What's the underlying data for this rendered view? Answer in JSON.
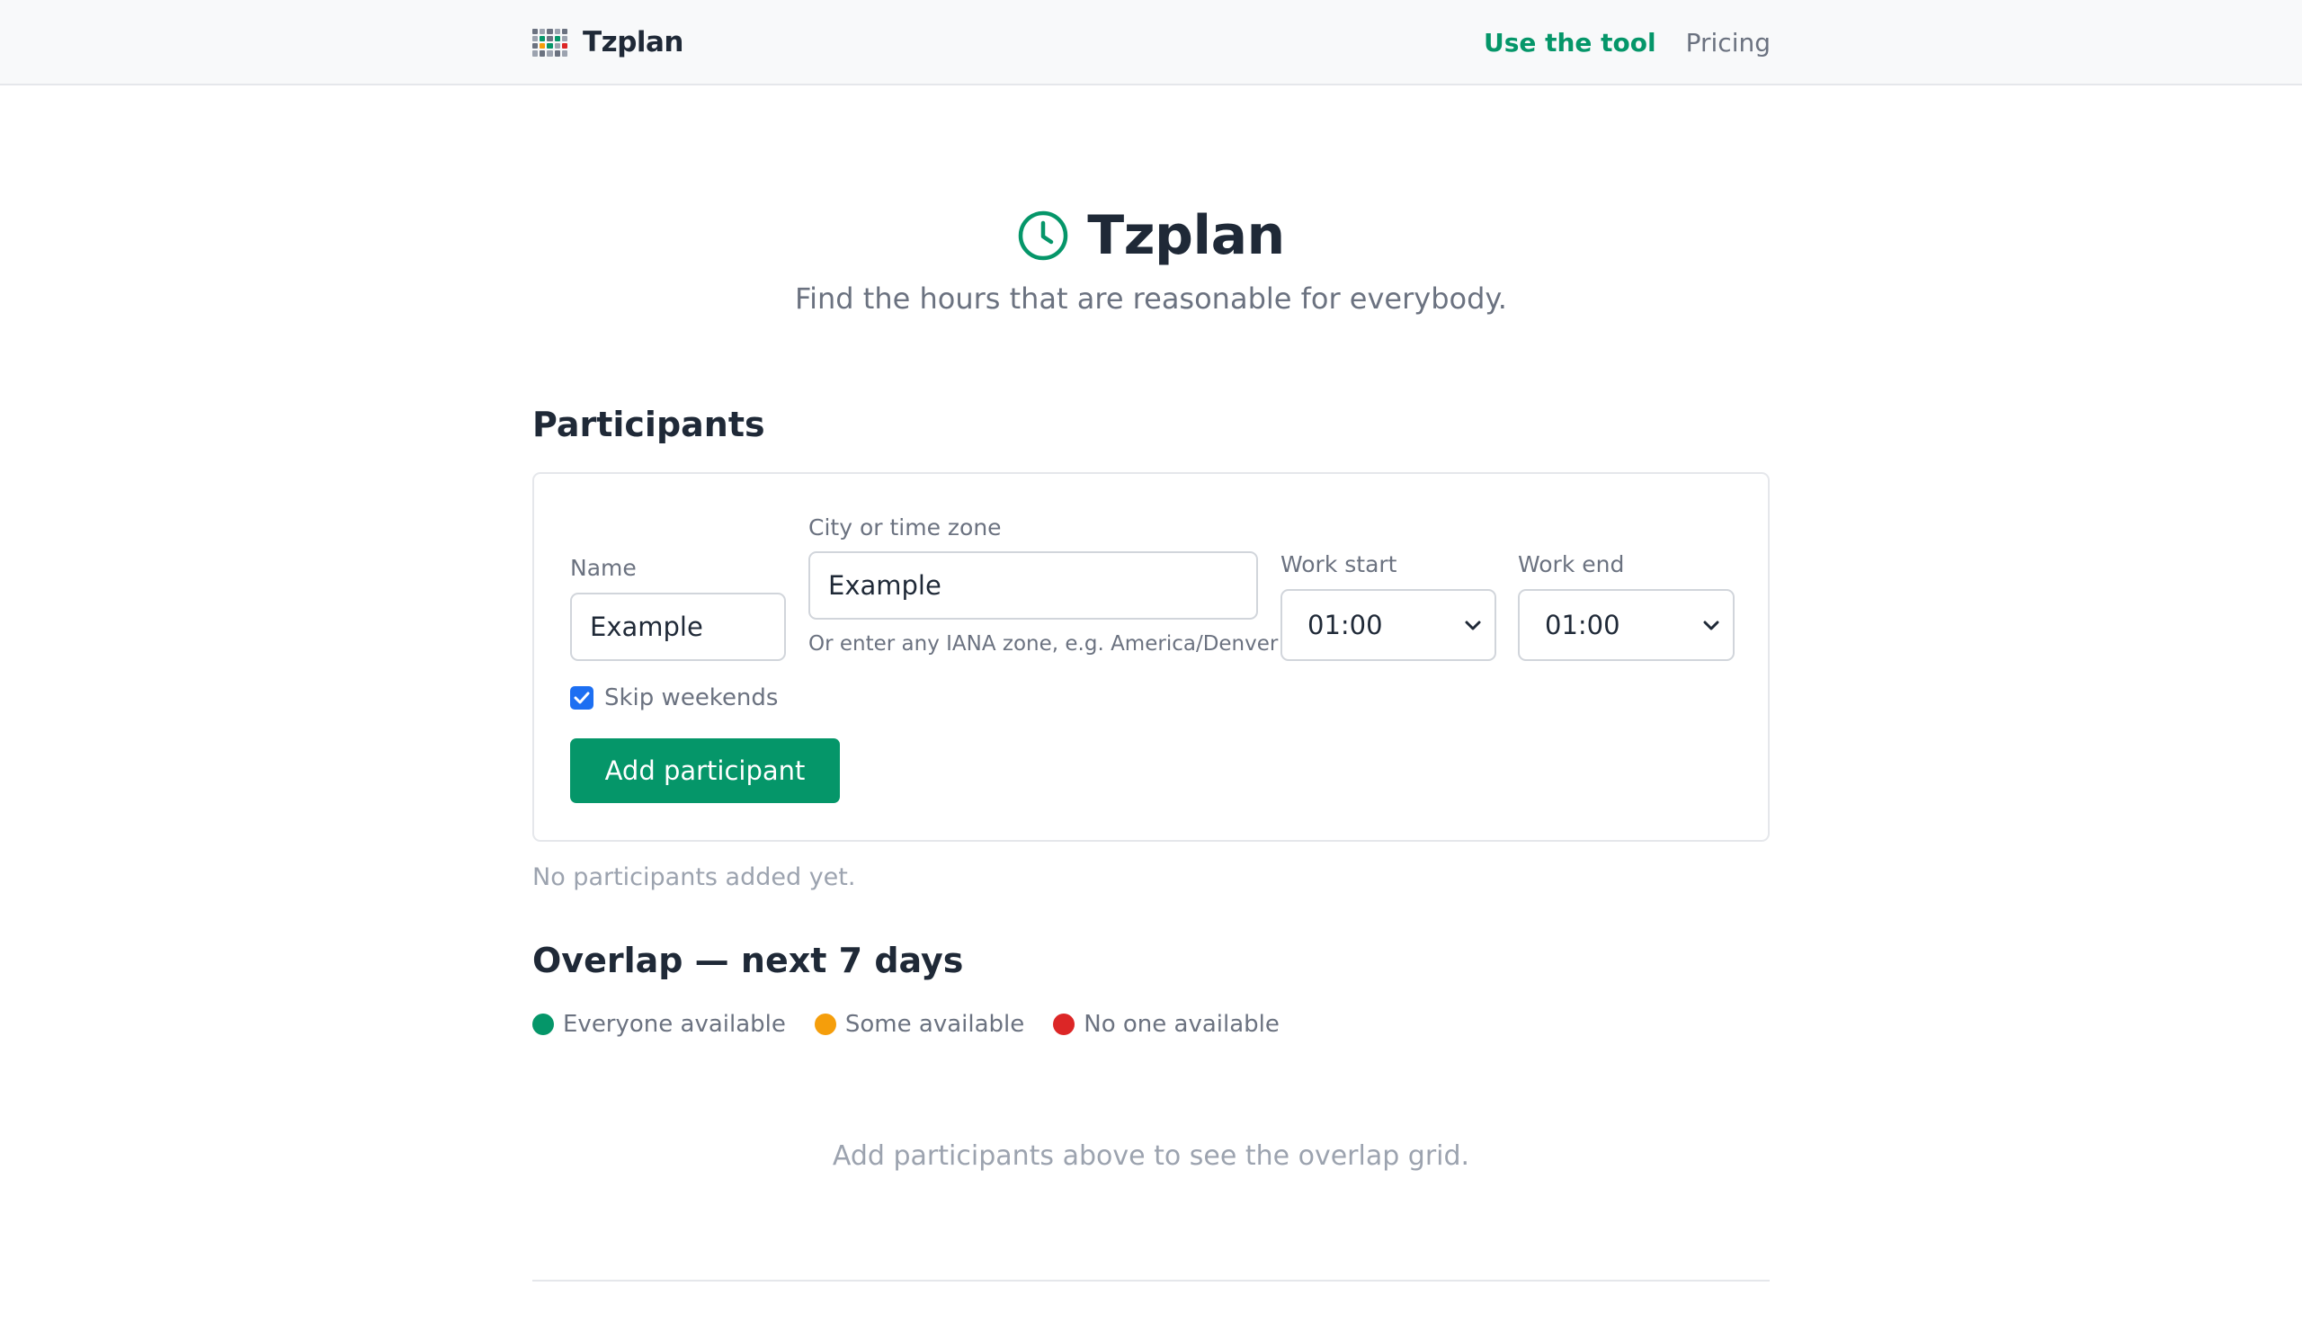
{
  "nav": {
    "brand": "Tzplan",
    "links": [
      "Use the tool",
      "Pricing"
    ]
  },
  "hero": {
    "title": "Tzplan",
    "subtitle": "Find the hours that are reasonable for everybody."
  },
  "participants": {
    "heading": "Participants",
    "name_label": "Name",
    "name_value": "Example",
    "zone_label": "City or time zone",
    "zone_value": "Example",
    "zone_hint": "Or enter any IANA zone, e.g. America/Denver",
    "work_start_label": "Work start",
    "work_start_value": "01:00",
    "work_end_label": "Work end",
    "work_end_value": "01:00",
    "skip_weekends_label": "Skip weekends",
    "skip_weekends_checked": true,
    "add_button": "Add participant",
    "empty_text": "No participants added yet."
  },
  "overlap": {
    "heading": "Overlap — next 7 days",
    "legend": [
      {
        "label": "Everyone available",
        "color": "#059669"
      },
      {
        "label": "Some available",
        "color": "#f59e0b"
      },
      {
        "label": "No one available",
        "color": "#dc2626"
      }
    ],
    "empty_text": "Add participants above to see the overlap grid."
  },
  "colors": {
    "accent": "#059669",
    "checkbox": "#1d6ff2"
  }
}
